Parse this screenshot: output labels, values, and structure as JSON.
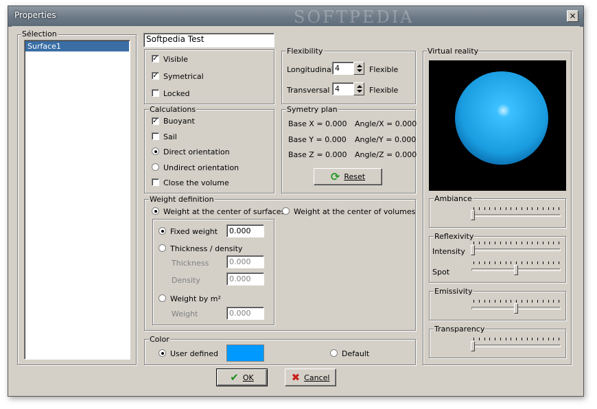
{
  "window": {
    "title": "Properties",
    "watermark": "SOFTPEDIA",
    "close_glyph": "×"
  },
  "selection": {
    "label": "Sélection",
    "items": [
      "Surface1"
    ],
    "selected": "Surface1"
  },
  "name_field": {
    "value": "Softpedia Test"
  },
  "options": {
    "visible": {
      "label": "Visible",
      "checked": true
    },
    "symetrical": {
      "label": "Symetrical",
      "checked": true
    },
    "locked": {
      "label": "Locked",
      "checked": false
    }
  },
  "flexibility": {
    "label": "Flexibility",
    "longitudinal": {
      "label": "Longitudinal",
      "value": "4",
      "unit": "Flexible"
    },
    "transversal": {
      "label": "Transversal",
      "value": "4",
      "unit": "Flexible"
    }
  },
  "calculations": {
    "label": "Calculations",
    "buoyant": {
      "label": "Buoyant",
      "checked": true
    },
    "sail": {
      "label": "Sail",
      "checked": false
    },
    "direct": {
      "label": "Direct orientation",
      "selected": true
    },
    "undirect": {
      "label": "Undirect orientation",
      "selected": false
    },
    "close_volume": {
      "label": "Close the volume",
      "checked": false
    }
  },
  "symetry_plan": {
    "label": "Symetry plan",
    "base_x": "Base X = 0.000",
    "angle_x": "Angle/X = 0.000",
    "base_y": "Base Y = 0.000",
    "angle_y": "Angle/Y = 0.000",
    "base_z": "Base Z = 0.000",
    "angle_z": "Angle/Z = 0.000",
    "reset_label": "Reset",
    "reset_icon": "refresh-icon"
  },
  "weight_definition": {
    "label": "Weight definition",
    "center_surfaces": {
      "label": "Weight at the center of surfaces",
      "selected": true
    },
    "center_volumes": {
      "label": "Weight at the center of volumes",
      "selected": false
    },
    "fixed_weight": {
      "label": "Fixed weight",
      "selected": true,
      "value": "0.000"
    },
    "thickness_density": {
      "label": "Thickness / density",
      "selected": false
    },
    "thickness": {
      "label": "Thickness",
      "value": "0.000"
    },
    "density": {
      "label": "Density",
      "value": "0.000"
    },
    "weight_by_m2": {
      "label": "Weight by m²",
      "selected": false
    },
    "weight": {
      "label": "Weight",
      "value": "0.000"
    }
  },
  "color": {
    "label": "Color",
    "user_defined": {
      "label": "User defined",
      "selected": true
    },
    "swatch": "#0099ff",
    "default": {
      "label": "Default",
      "selected": false
    }
  },
  "virtual_reality": {
    "label": "Virtual reality",
    "sphere_color": "#1fa2e6",
    "ambiance": {
      "label": "Ambiance",
      "level": 0
    },
    "reflexivity": {
      "label": "Reflexivity",
      "intensity": {
        "label": "Intensity",
        "level": 0
      },
      "spot": {
        "label": "Spot",
        "level": 0.5
      }
    },
    "emissivity": {
      "label": "Emissivity",
      "level": 0.5
    },
    "transparency": {
      "label": "Transparency",
      "level": 0
    }
  },
  "buttons": {
    "ok": {
      "label": "OK",
      "icon": "check-icon"
    },
    "cancel": {
      "label": "Cancel",
      "icon": "x-icon"
    }
  }
}
